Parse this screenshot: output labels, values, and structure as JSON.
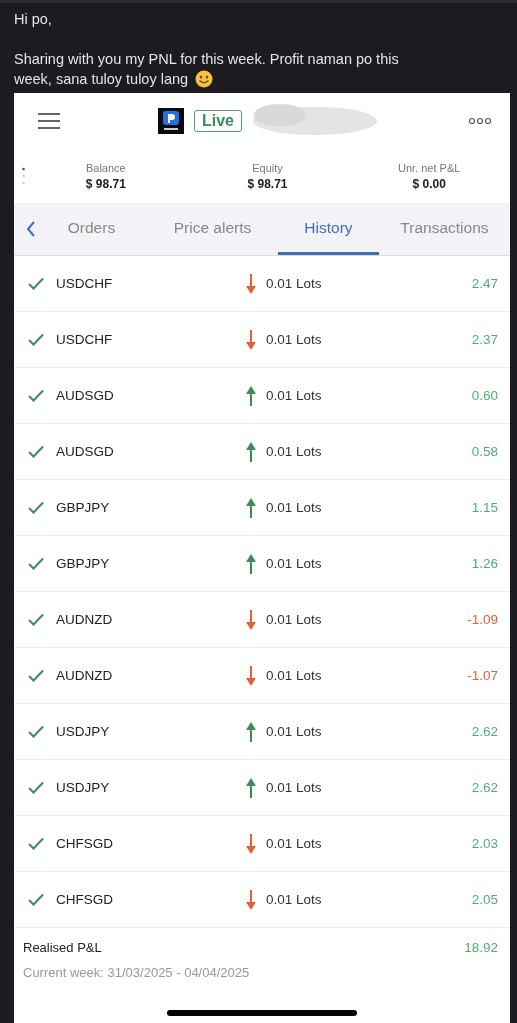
{
  "message": {
    "greeting": "Hi po,",
    "body_lines": [
      "Sharing with you my PNL for this week. Profit naman po this",
      "week, sana tuloy tuloy lang"
    ]
  },
  "app": {
    "badge": "Live",
    "stats": [
      {
        "label": "Balance",
        "value": "$ 98.71"
      },
      {
        "label": "Equity",
        "value": "$ 98.71"
      },
      {
        "label": "Unr. net P&L",
        "value": "$ 0.00"
      }
    ],
    "tabs": [
      {
        "label": "Orders",
        "selected": false
      },
      {
        "label": "Price alerts",
        "selected": false
      },
      {
        "label": "History",
        "selected": true
      },
      {
        "label": "Transactions",
        "selected": false
      }
    ],
    "trades": [
      {
        "symbol": "USDCHF",
        "up": false,
        "size": "0.01 Lots",
        "pnl": "2.47",
        "color": "#4caf7a"
      },
      {
        "symbol": "USDCHF",
        "up": false,
        "size": "0.01 Lots",
        "pnl": "2.37",
        "color": "#4caf7a"
      },
      {
        "symbol": "AUDSGD",
        "up": true,
        "size": "0.01 Lots",
        "pnl": "0.60",
        "color": "#4caf7a"
      },
      {
        "symbol": "AUDSGD",
        "up": true,
        "size": "0.01 Lots",
        "pnl": "0.58",
        "color": "#4caf7a"
      },
      {
        "symbol": "GBPJPY",
        "up": true,
        "size": "0.01 Lots",
        "pnl": "1.15",
        "color": "#4caf7a"
      },
      {
        "symbol": "GBPJPY",
        "up": true,
        "size": "0.01 Lots",
        "pnl": "1.26",
        "color": "#4caf7a"
      },
      {
        "symbol": "AUDNZD",
        "up": false,
        "size": "0.01 Lots",
        "pnl": "-1.09",
        "color": "#e2603a"
      },
      {
        "symbol": "AUDNZD",
        "up": false,
        "size": "0.01 Lots",
        "pnl": "-1.07",
        "color": "#e2603a"
      },
      {
        "symbol": "USDJPY",
        "up": true,
        "size": "0.01 Lots",
        "pnl": "2.62",
        "color": "#4caf7a"
      },
      {
        "symbol": "USDJPY",
        "up": true,
        "size": "0.01 Lots",
        "pnl": "2.62",
        "color": "#4caf7a"
      },
      {
        "symbol": "CHFSGD",
        "up": false,
        "size": "0.01 Lots",
        "pnl": "2.03",
        "color": "#4caf7a"
      },
      {
        "symbol": "CHFSGD",
        "up": false,
        "size": "0.01 Lots",
        "pnl": "2.05",
        "color": "#4caf7a"
      }
    ],
    "summary": {
      "label": "Realised P&L",
      "value": "18.92",
      "period": "Current week: 31/03/2025 - 04/04/2025"
    }
  }
}
